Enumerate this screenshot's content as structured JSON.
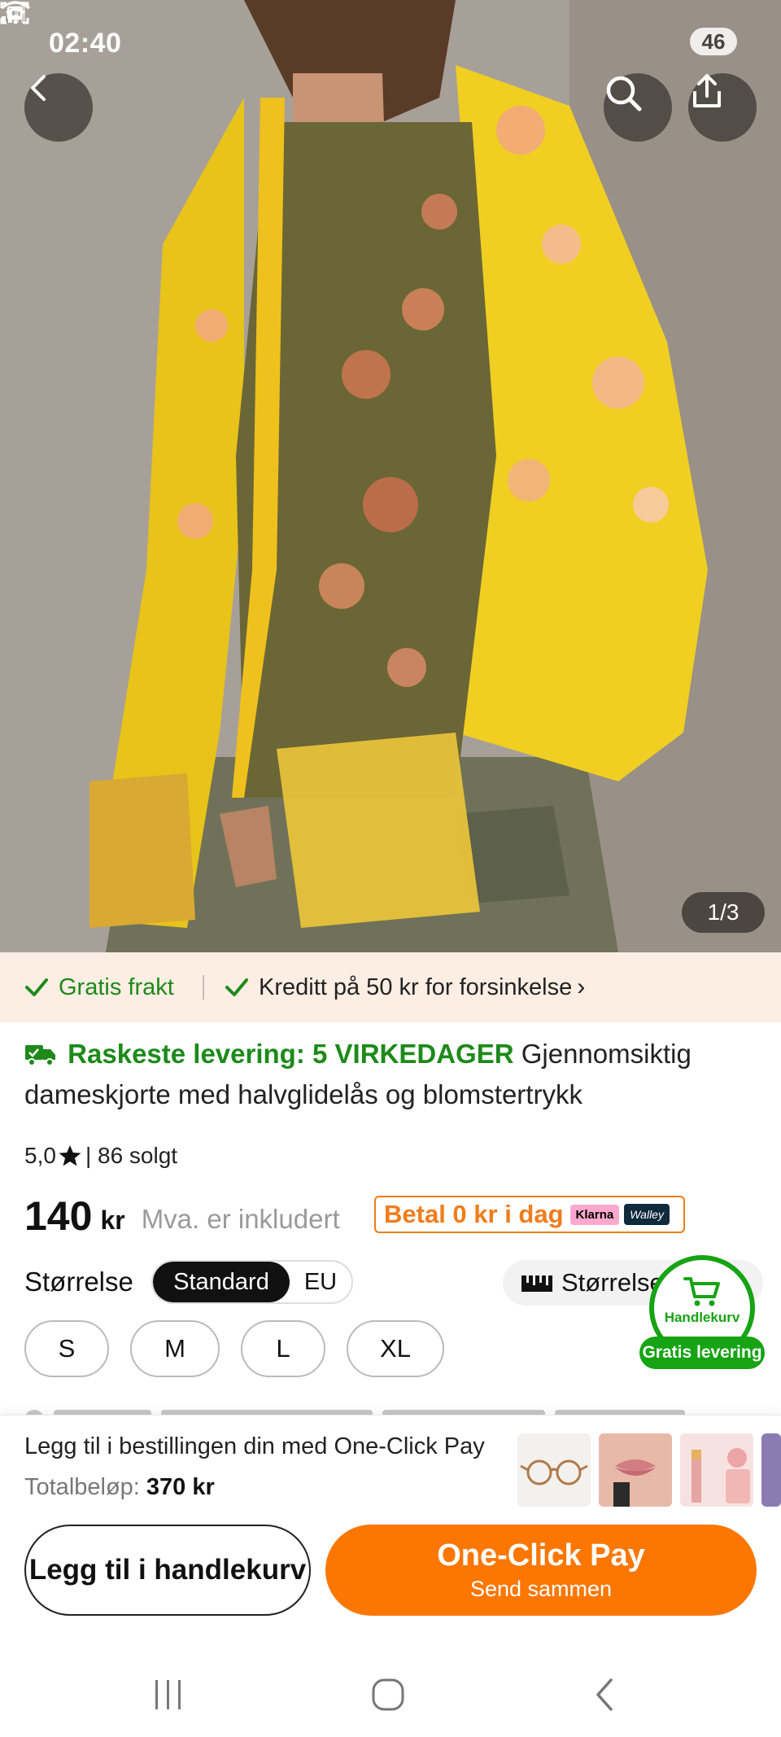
{
  "status": {
    "time": "02:40",
    "battery": "46"
  },
  "gallery": {
    "counter": "1/3"
  },
  "promo": {
    "free_shipping": "Gratis frakt",
    "credit": "Kreditt på 50 kr for forsinkelse"
  },
  "product": {
    "fast_delivery": "Raskeste levering: 5 VIRKEDAGER",
    "title": "Gjennomsiktig dameskjorte med halvglidelås og blomstertrykk",
    "rating": "5,0",
    "sold": "| 86 solgt",
    "price": "140",
    "currency": "kr",
    "vat_note": "Mva. er inkludert",
    "pay_later": "Betal 0 kr i dag",
    "klarna": "Klarna",
    "walley": "Walley"
  },
  "size": {
    "label": "Størrelse",
    "toggle": [
      "Standard",
      "EU"
    ],
    "guide": "Størrelse",
    "options": [
      "S",
      "M",
      "L",
      "XL"
    ]
  },
  "cart_float": {
    "label": "Handlekurv",
    "pill": "Gratis levering"
  },
  "one_click": {
    "line1": "Legg til i bestillingen din med One-Click Pay",
    "total_label": "Totalbeløp:",
    "total_value": "370 kr"
  },
  "buttons": {
    "add_to_cart": "Legg til i handlekurv",
    "pay_main": "One-Click Pay",
    "pay_sub": "Send sammen"
  },
  "colors": {
    "accent": "#fb7701",
    "green": "#16a314",
    "promo_bg": "#fdeee4"
  }
}
